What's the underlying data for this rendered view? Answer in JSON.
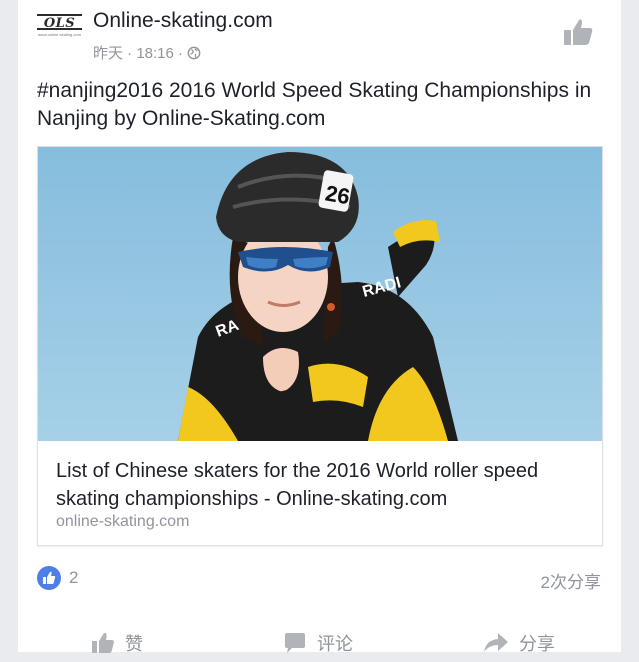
{
  "post": {
    "page_name": "Online-skating.com",
    "time": "昨天 · 18:16 ·",
    "text": "#nanjing2016 2016 World Speed Skating Championships in Nanjing by Online-Skating.com",
    "logo_text": "OLS",
    "logo_subtext": "www.online-skating.com"
  },
  "link": {
    "title": "List of Chinese skaters for the 2016 World roller speed skating championships - Online-skating.com",
    "domain": "online-skating.com",
    "image_alt": "skater in black and yellow Radius jersey with number 26 helmet"
  },
  "stats": {
    "reaction_count": "2",
    "shares": "2次分享"
  },
  "actions": {
    "like": "赞",
    "comment": "评论",
    "share": "分享"
  },
  "colors": {
    "accent": "#4e7fe6",
    "text": "#1d2129",
    "muted": "#90949c",
    "sky": "#8fc2df",
    "jersey_yellow": "#f2c81f"
  }
}
